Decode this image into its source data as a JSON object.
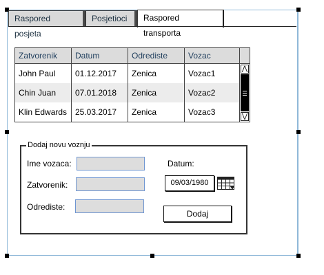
{
  "tabs": [
    {
      "label": "Raspored posjeta",
      "active": false
    },
    {
      "label": "Posjetioci",
      "active": false
    },
    {
      "label": "Raspored transporta",
      "active": true
    }
  ],
  "table": {
    "columns": [
      "Zatvorenik",
      "Datum",
      "Odrediste",
      "Vozac"
    ],
    "rows": [
      [
        "John Paul",
        "01.12.2017",
        "Zenica",
        "Vozac1"
      ],
      [
        "Chin Juan",
        "07.01.2018",
        "Zenica",
        "Vozac2"
      ],
      [
        "Klin Edwards",
        "25.03.2017",
        "Zenica",
        "Vozac3"
      ]
    ],
    "scroll_up_glyph": "⋀",
    "scroll_down_glyph": "⋁"
  },
  "form": {
    "title": "Dodaj novu voznju",
    "driver_label": "Ime vozaca:",
    "driver_value": "",
    "prisoner_label": "Zatvorenik:",
    "prisoner_value": "",
    "destination_label": "Odrediste:",
    "destination_value": "",
    "date_label": "Datum:",
    "date_value": "09/03/1980",
    "calendar_icon": "calendar-icon",
    "add_label": "Dodaj"
  },
  "colors": {
    "header_text": "#1e3d5c",
    "field_border": "#6e95d1",
    "field_fill": "#dddddd",
    "selection_frame": "#8fb8d8"
  }
}
